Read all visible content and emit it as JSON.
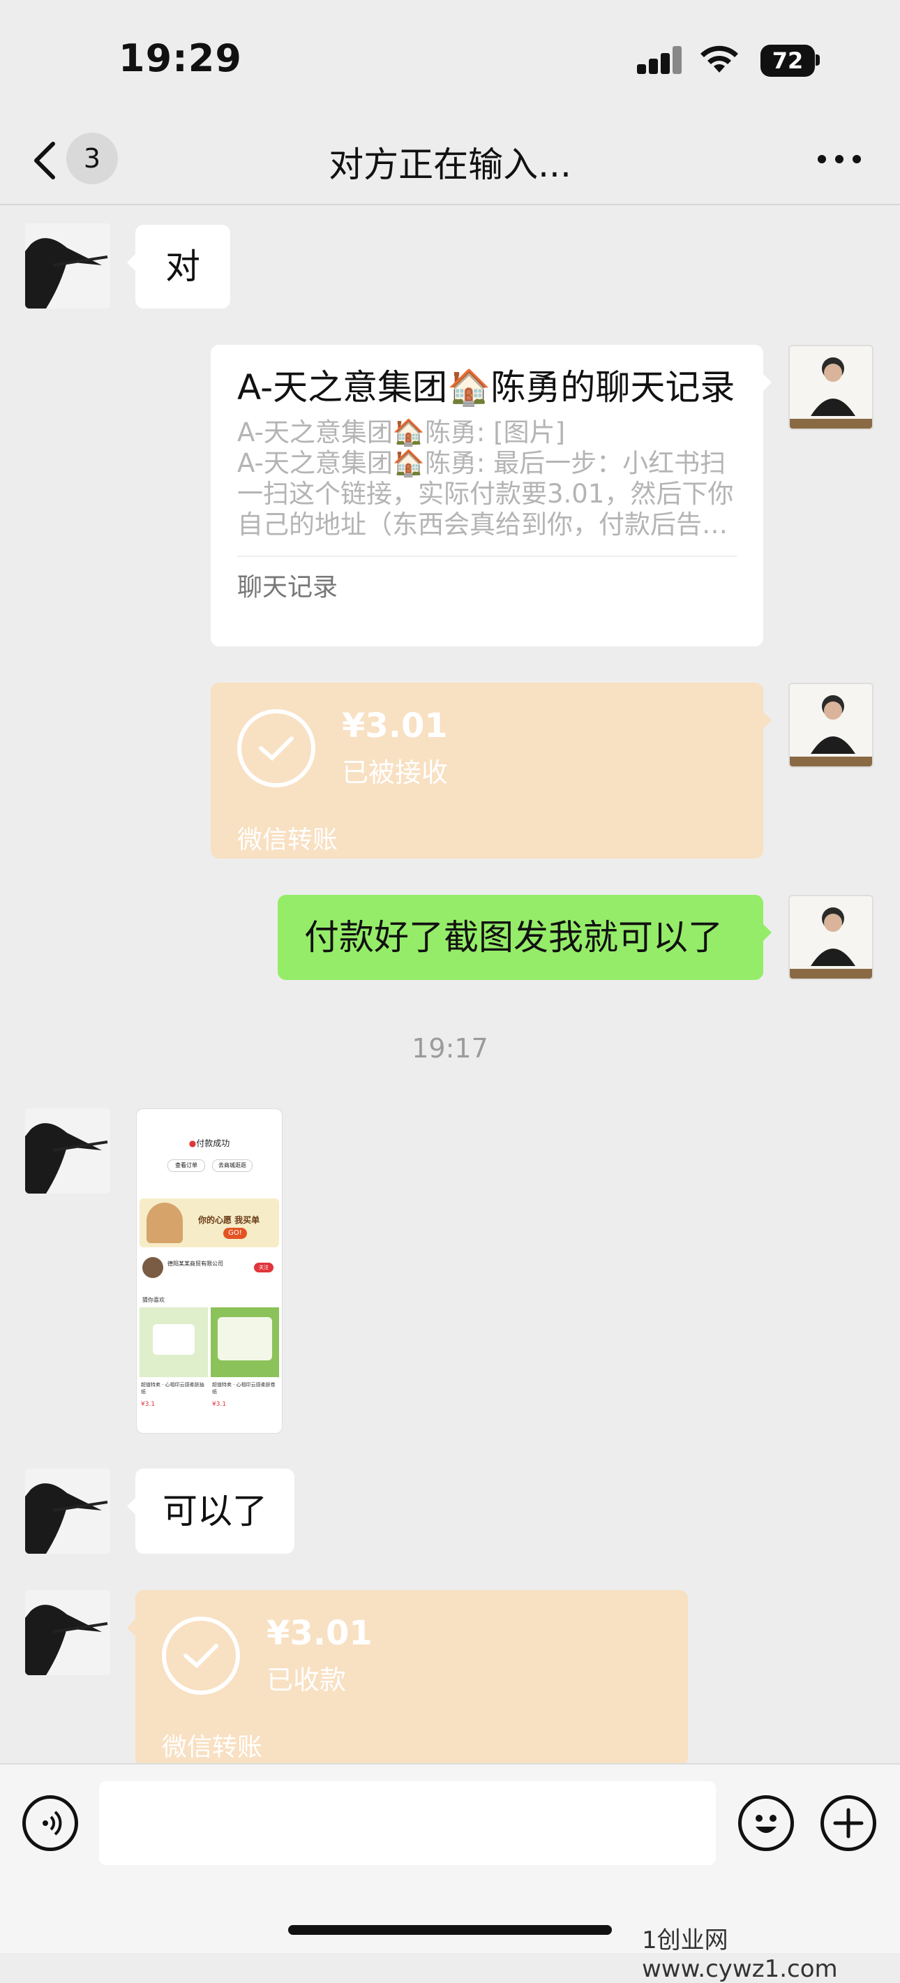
{
  "status_bar": {
    "time": "19:29",
    "battery": "72"
  },
  "nav": {
    "unread_count": "3",
    "title": "对方正在输入..."
  },
  "messages": {
    "m1_text": "对",
    "record": {
      "title_part1": "A-天之意集团",
      "title_part2": "陈勇的聊天记录",
      "line1_name": "A-天之意集团",
      "line1_text": "陈勇: [图片]",
      "line2_name": "A-天之意集团",
      "line2_text": "陈勇: 最后一步：小红书扫",
      "line3": "一扫这个链接，实际付款要3.01，然后下你",
      "line4": "自己的地址（东西会真给到你，付款后告…",
      "footer": "聊天记录"
    },
    "transfer_sent": {
      "amount": "¥3.01",
      "status": "已被接收",
      "footer": "微信转账"
    },
    "m4_text": "付款好了截图发我就可以了",
    "timestamp": "19:17",
    "screenshot": {
      "success": "付款成功",
      "btn1": "查看订单",
      "btn2": "去商城逛逛",
      "banner": "你的心愿 我买单",
      "banner_go": "GO!",
      "store": "德阳某某商贸有限公司",
      "store_follow": "关注",
      "guess": "猜你喜欢",
      "item1": "超值特卖 · 心相印云感柔肤抽纸",
      "item2": "超值特卖 · 心相印云感柔肤卷纸",
      "price": "¥3.1"
    },
    "m6_text": "可以了",
    "transfer_received": {
      "amount": "¥3.01",
      "status": "已收款",
      "footer": "微信转账"
    }
  },
  "watermark": "1创业网www.cywz1.com",
  "colors": {
    "bg": "#ededed",
    "green_bubble": "#95ec69",
    "transfer_bubble": "#f8e0c2"
  }
}
